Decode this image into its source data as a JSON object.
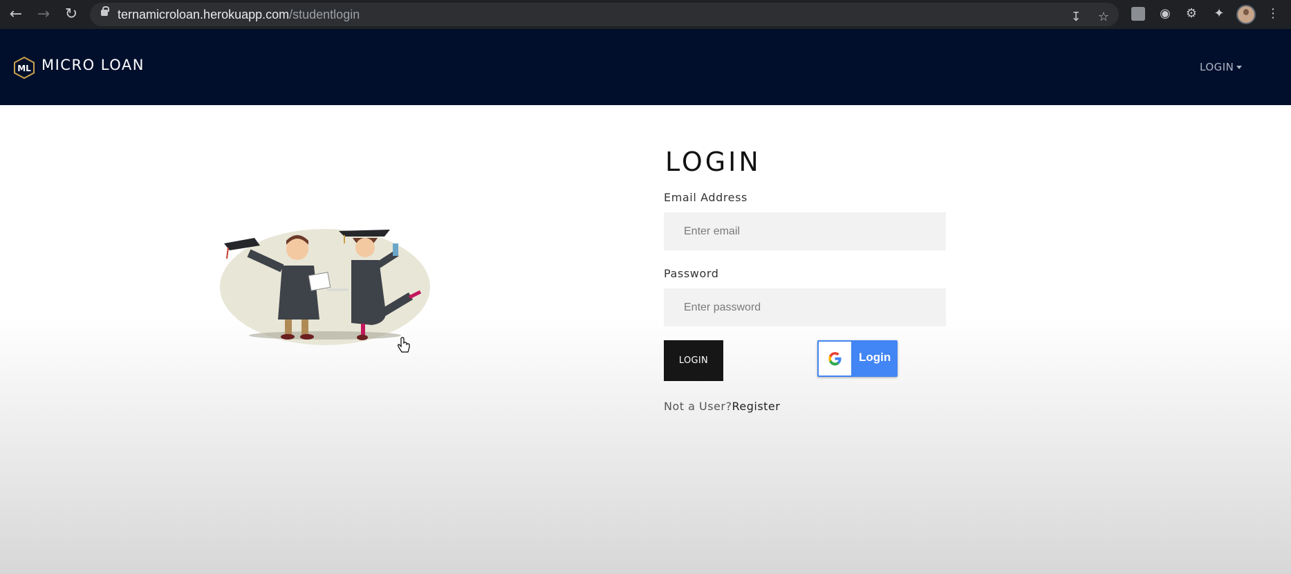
{
  "browser": {
    "url_host": "ternamicroloan.herokuapp.com",
    "url_path": "/studentlogin",
    "icons": [
      "back-arrow-icon",
      "forward-arrow-icon",
      "reload-icon",
      "lock-icon",
      "install-icon",
      "star-icon",
      "extension-icon",
      "camera-icon",
      "extension-icon",
      "puzzle-icon",
      "avatar",
      "more-vertical-icon"
    ]
  },
  "navbar": {
    "brand": "MICRO LOAN",
    "logo_letters": "ML",
    "login_menu": "LOGIN",
    "background": "#010f2c"
  },
  "form": {
    "title": "LOGIN",
    "email_label": "Email Address",
    "email_placeholder": "Enter email",
    "password_label": "Password",
    "password_placeholder": "Enter password",
    "login_button": "LOGIN",
    "google_button": "Login",
    "not_user_text": "Not a User?",
    "register_link": "Register"
  },
  "colors": {
    "login_button": "#161616",
    "google_button": "#4285f4"
  }
}
